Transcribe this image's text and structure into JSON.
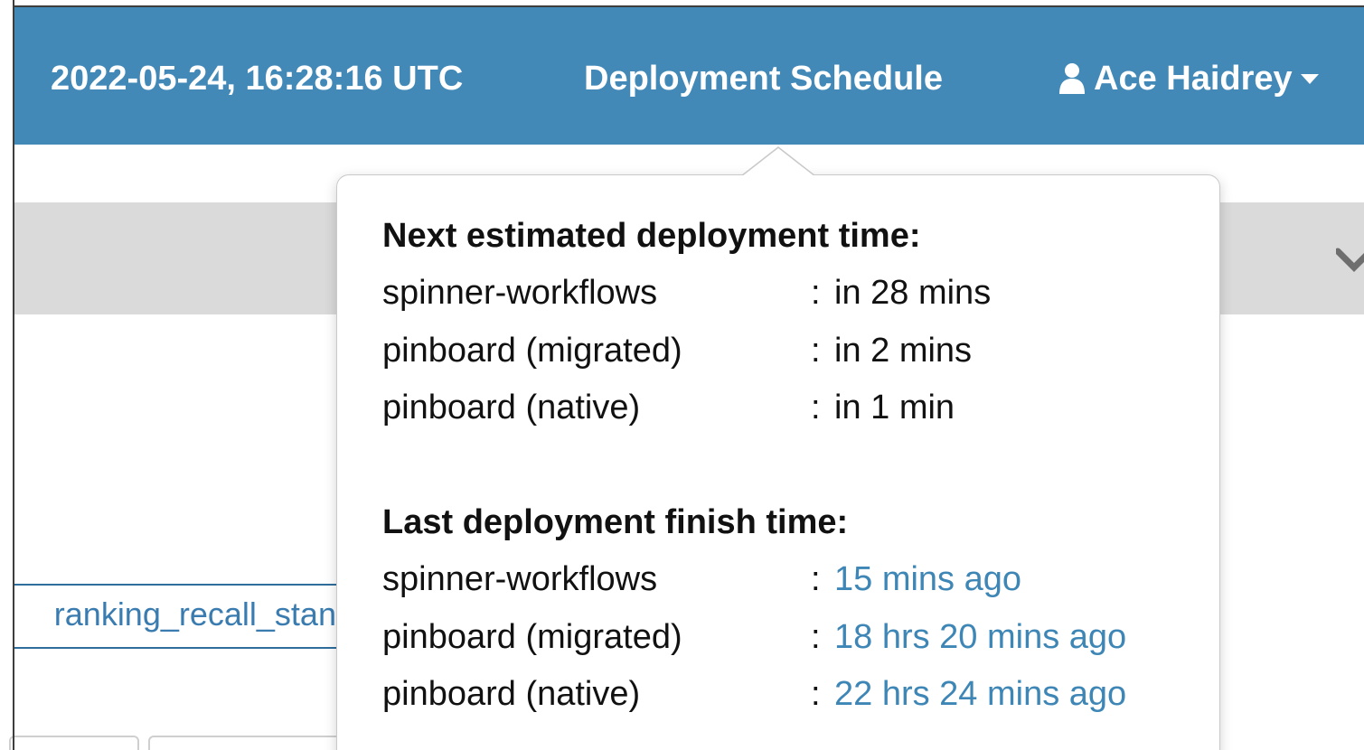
{
  "header": {
    "timestamp": "2022-05-24, 16:28:16 UTC",
    "schedule_label": "Deployment Schedule",
    "user_name": "Ace Haidrey",
    "user_icon": "user-icon",
    "menu_icon": "caret-down-icon"
  },
  "background": {
    "field_text": "ranking_recall_stand",
    "collapse_icon": "chevron-down-icon"
  },
  "popover": {
    "next_title": "Next estimated deployment time:",
    "next_items": [
      {
        "name": "spinner-workflows",
        "sep": ":",
        "value": "in 28 mins"
      },
      {
        "name": "pinboard (migrated)",
        "sep": ":",
        "value": "in 2 mins"
      },
      {
        "name": "pinboard (native)",
        "sep": ":",
        "value": "in 1 min"
      }
    ],
    "last_title": "Last deployment finish time:",
    "last_items": [
      {
        "name": "spinner-workflows",
        "sep": ":",
        "value": "15 mins ago"
      },
      {
        "name": "pinboard (migrated)",
        "sep": ":",
        "value": "18 hrs 20 mins ago"
      },
      {
        "name": "pinboard (native)",
        "sep": ":",
        "value": "22 hrs 24 mins ago"
      }
    ]
  },
  "colors": {
    "navbar": "#4289b8",
    "link": "#3d86b5",
    "band": "#dadada"
  }
}
